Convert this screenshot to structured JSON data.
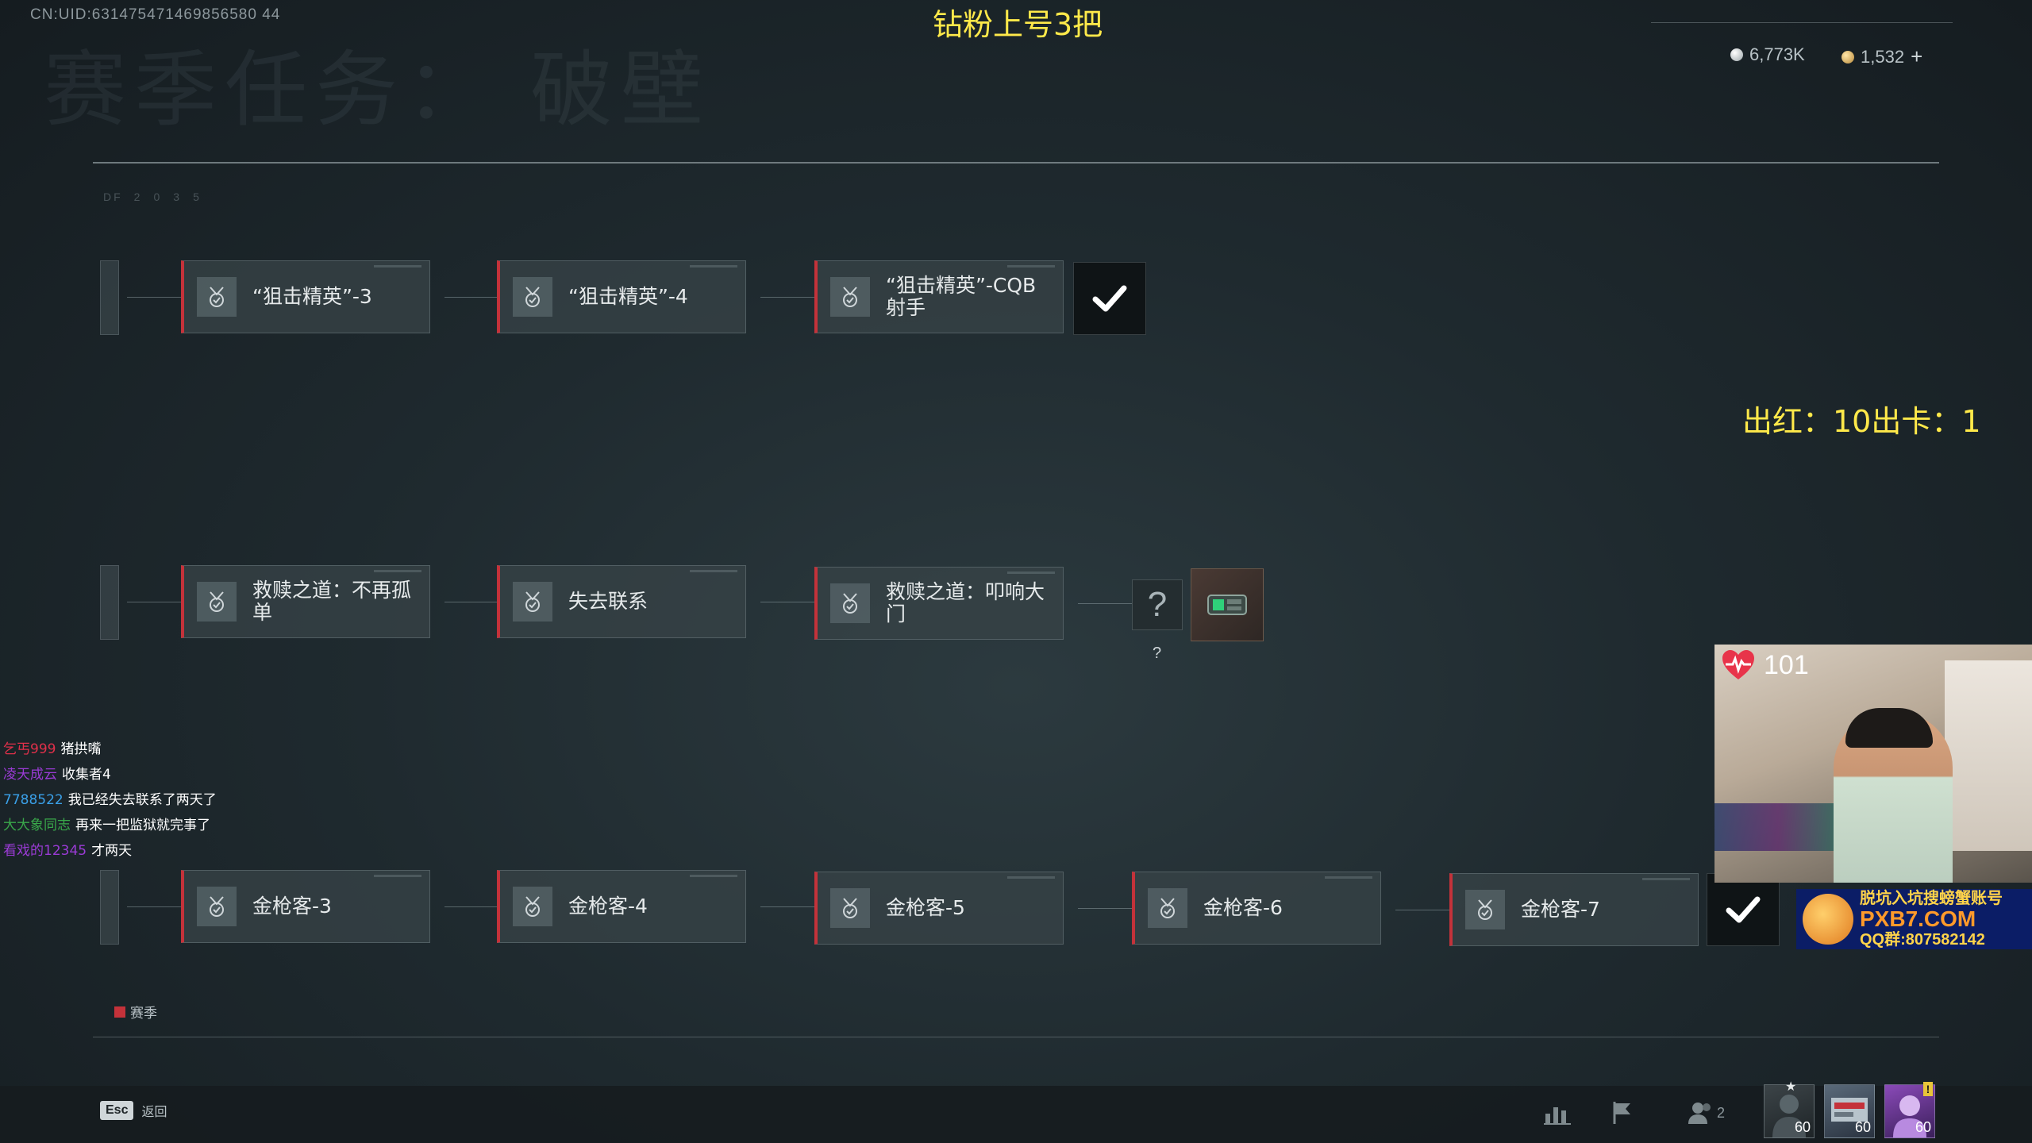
{
  "header": {
    "uid": "CN:UID:631475471469856580 44",
    "watermark_title": "赛季任务： 破壁",
    "stream_title": "钻粉上号3把",
    "currency_silver": "6,773K",
    "currency_gold": "1,532",
    "currency_add": "+"
  },
  "panel": {
    "faint_labels": {
      "tab": "DF",
      "numbers": [
        "2",
        "0",
        "3",
        "5"
      ]
    }
  },
  "rows": [
    {
      "tasks": [
        {
          "label": "“狙击精英”-3",
          "icon": "medal-icon"
        },
        {
          "label": "“狙击精英”-4",
          "icon": "medal-icon"
        },
        {
          "label": "“狙击精英”-CQB射手",
          "icon": "medal-icon"
        }
      ],
      "reward": {
        "type": "checkmark",
        "icon": "checkmark-icon"
      }
    },
    {
      "tasks": [
        {
          "label": "救赎之道：不再孤单",
          "icon": "medal-icon"
        },
        {
          "label": "失去联系",
          "icon": "medal-icon"
        },
        {
          "label": "救赎之道：叩响大门",
          "icon": "medal-icon"
        }
      ],
      "unknown": "?",
      "unknown_hint": "?",
      "reward": {
        "type": "item",
        "icon": "gadget-item-icon"
      }
    },
    {
      "tasks": [
        {
          "label": "金枪客-3",
          "icon": "medal-icon"
        },
        {
          "label": "金枪客-4",
          "icon": "medal-icon"
        },
        {
          "label": "金枪客-5",
          "icon": "medal-icon"
        },
        {
          "label": "金枪客-6",
          "icon": "medal-icon"
        },
        {
          "label": "金枪客-7",
          "icon": "medal-icon"
        }
      ],
      "reward": {
        "type": "checkmark",
        "icon": "checkmark-icon"
      }
    }
  ],
  "overlay": {
    "red_stat": "出红：10出卡：1",
    "heart_rate": "101",
    "ad_line1": "脱坑入坑搜螃蟹账号",
    "ad_line2": "PXB7.COM",
    "ad_line3": "QQ群:807582142"
  },
  "chat": [
    {
      "user": "乞丐999",
      "msg": "猪拱嘴",
      "color": "#e0304a"
    },
    {
      "user": "凌天成云",
      "msg": "收集者4",
      "color": "#9b3bd6"
    },
    {
      "user": "7788522",
      "msg": "我已经失去联系了两天了",
      "color": "#3aa0e8"
    },
    {
      "user": "大大象同志",
      "msg": "再来一把监狱就完事了",
      "color": "#39a84a"
    },
    {
      "user": "看戏的12345",
      "msg": "才两天",
      "color": "#9b3bd6"
    }
  ],
  "legend": {
    "season_label": "赛季",
    "season_color": "#c4323a"
  },
  "footer": {
    "esc_key": "Esc",
    "esc_label": "返回",
    "friends_count": "2",
    "slots": [
      {
        "num": "60",
        "icon": "operator-avatar-icon"
      },
      {
        "num": "60",
        "icon": "badge-card-icon"
      },
      {
        "num": "60",
        "icon": "player-avatar-icon",
        "badge": "!"
      }
    ]
  }
}
